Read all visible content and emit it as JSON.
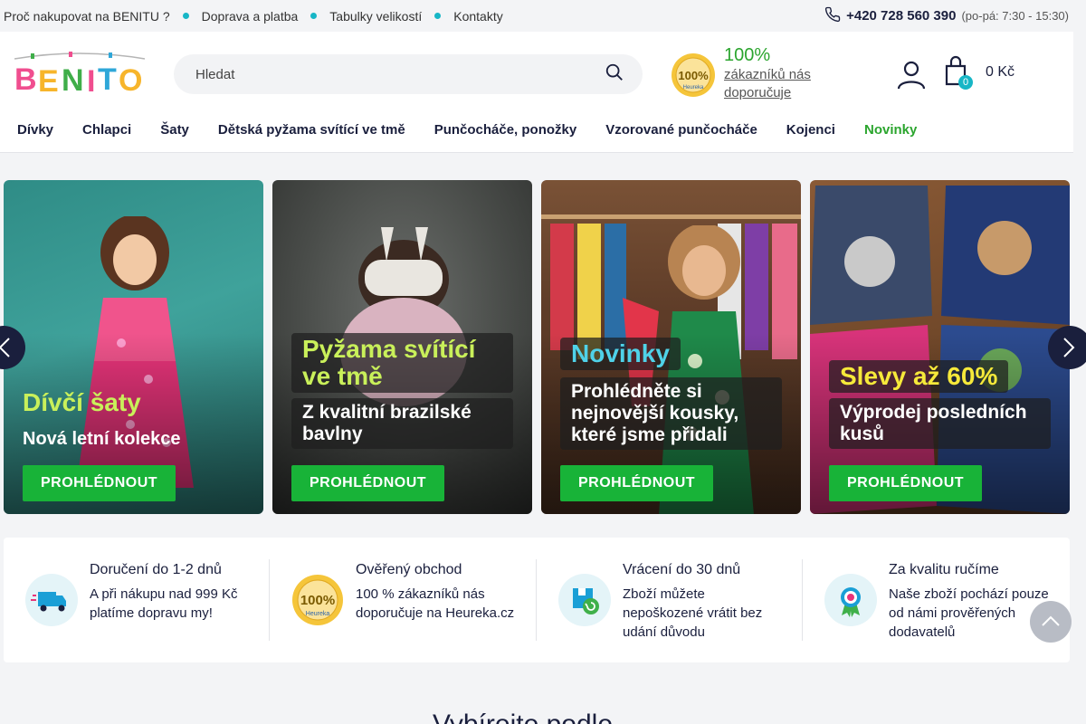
{
  "topbar": {
    "links": [
      "Proč nakupovat na BENITU ?",
      "Doprava a platba",
      "Tabulky velikostí",
      "Kontakty"
    ],
    "phone": "+420 728 560 390",
    "hours": "(po-pá: 7:30 - 15:30)"
  },
  "header": {
    "logo_text": "BENITO",
    "search_placeholder": "Hledat",
    "heureka_pct": "100%",
    "heureka_text": "zákazníků nás doporučuje",
    "cart_count": "0",
    "cart_price": "0 Kč"
  },
  "nav": [
    "Dívky",
    "Chlapci",
    "Šaty",
    "Dětská pyžama svítící ve tmě",
    "Punčocháče, ponožky",
    "Vzorované punčocháče",
    "Kojenci",
    "Novinky"
  ],
  "banners": [
    {
      "title": "Dívčí šaty",
      "subtitle": "Nová letní kolekce",
      "button": "PROHLÉDNOUT"
    },
    {
      "title": "Pyžama svítící ve tmě",
      "subtitle": "Z kvalitní brazilské bavlny",
      "button": "PROHLÉDNOUT"
    },
    {
      "title": "Novinky",
      "subtitle": "Prohlédněte si nejnovější kousky, které jsme přidali",
      "button": "PROHLÉDNOUT"
    },
    {
      "title": "Slevy až 60%",
      "subtitle": "Výprodej posledních kusů",
      "button": "PROHLÉDNOUT"
    }
  ],
  "features": [
    {
      "title": "Doručení do 1-2 dnů",
      "desc": "A při nákupu nad 999 Kč platíme dopravu my!",
      "icon": "delivery-truck-icon"
    },
    {
      "title": "Ověřený obchod",
      "desc": "100 % zákazníků nás doporučuje na Heureka.cz",
      "icon": "heureka-badge-icon"
    },
    {
      "title": "Vrácení do 30 dnů",
      "desc": "Zboží můžete nepoškozené vrátit bez udání důvodu",
      "icon": "return-box-icon"
    },
    {
      "title": "Za kvalitu ručíme",
      "desc": "Naše zboží pochází pouze od námi prověřených dodavatelů",
      "icon": "quality-ribbon-icon"
    }
  ],
  "bottom_heading": "Vybírejte podle"
}
